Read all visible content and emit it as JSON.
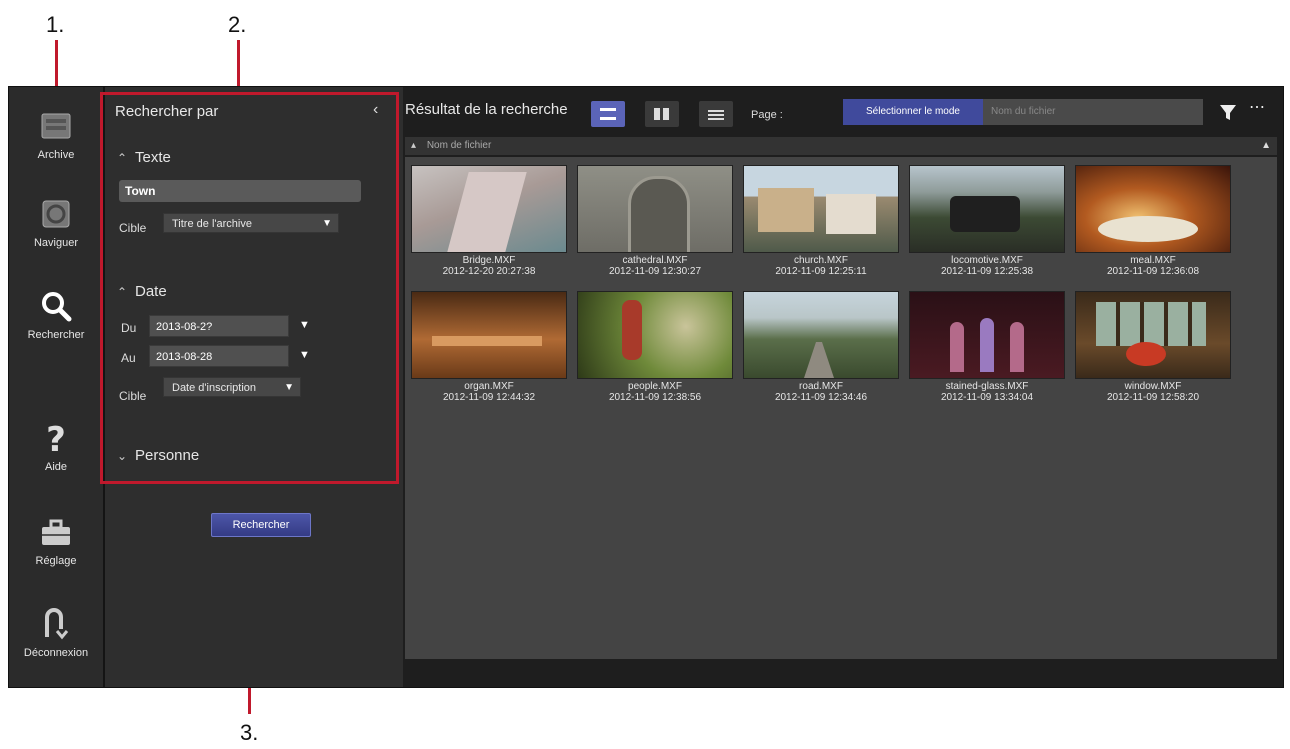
{
  "callouts": [
    "1.",
    "2.",
    "3."
  ],
  "nav": {
    "items": [
      {
        "label": "Archive",
        "icon": "archive-icon"
      },
      {
        "label": "Naviguer",
        "icon": "browse-icon"
      },
      {
        "label": "Rechercher",
        "icon": "search-icon"
      },
      {
        "label": "Aide",
        "icon": "help-icon"
      },
      {
        "label": "Réglage",
        "icon": "toolbox-icon"
      },
      {
        "label": "Déconnexion",
        "icon": "logout-icon"
      }
    ]
  },
  "search_panel": {
    "title": "Rechercher par",
    "collapse_icon": "chevron-left-icon",
    "text_section": {
      "label": "Texte",
      "input_value": "Town",
      "target_label": "Cible",
      "target_value": "Titre de l'archive"
    },
    "date_section": {
      "label": "Date",
      "from_label": "Du",
      "from_value": "2013-08-2?",
      "to_label": "Au",
      "to_value": "2013-08-28",
      "target_label": "Cible",
      "target_value": "Date d'inscription"
    },
    "person_section": {
      "label": "Personne"
    },
    "search_button": "Rechercher"
  },
  "results": {
    "title": "Résultat de la recherche",
    "page_label": "Page :",
    "mode_button": "Sélectionner le mode",
    "mode_placeholder": "Nom du fichier",
    "sort_label": "Nom de fichier",
    "items": [
      {
        "name": "Bridge.MXF",
        "timestamp": "2012-12-20 20:27:38"
      },
      {
        "name": "cathedral.MXF",
        "timestamp": "2012-11-09 12:30:27"
      },
      {
        "name": "church.MXF",
        "timestamp": "2012-11-09 12:25:11"
      },
      {
        "name": "locomotive.MXF",
        "timestamp": "2012-11-09 12:25:38"
      },
      {
        "name": "meal.MXF",
        "timestamp": "2012-11-09 12:36:08"
      },
      {
        "name": "organ.MXF",
        "timestamp": "2012-11-09 12:44:32"
      },
      {
        "name": "people.MXF",
        "timestamp": "2012-11-09 12:38:56"
      },
      {
        "name": "road.MXF",
        "timestamp": "2012-11-09 12:34:46"
      },
      {
        "name": "stained-glass.MXF",
        "timestamp": "2012-11-09 13:34:04"
      },
      {
        "name": "window.MXF",
        "timestamp": "2012-11-09 12:58:20"
      }
    ]
  },
  "colors": {
    "accent": "#c0192c",
    "active": "#5b64b8"
  }
}
